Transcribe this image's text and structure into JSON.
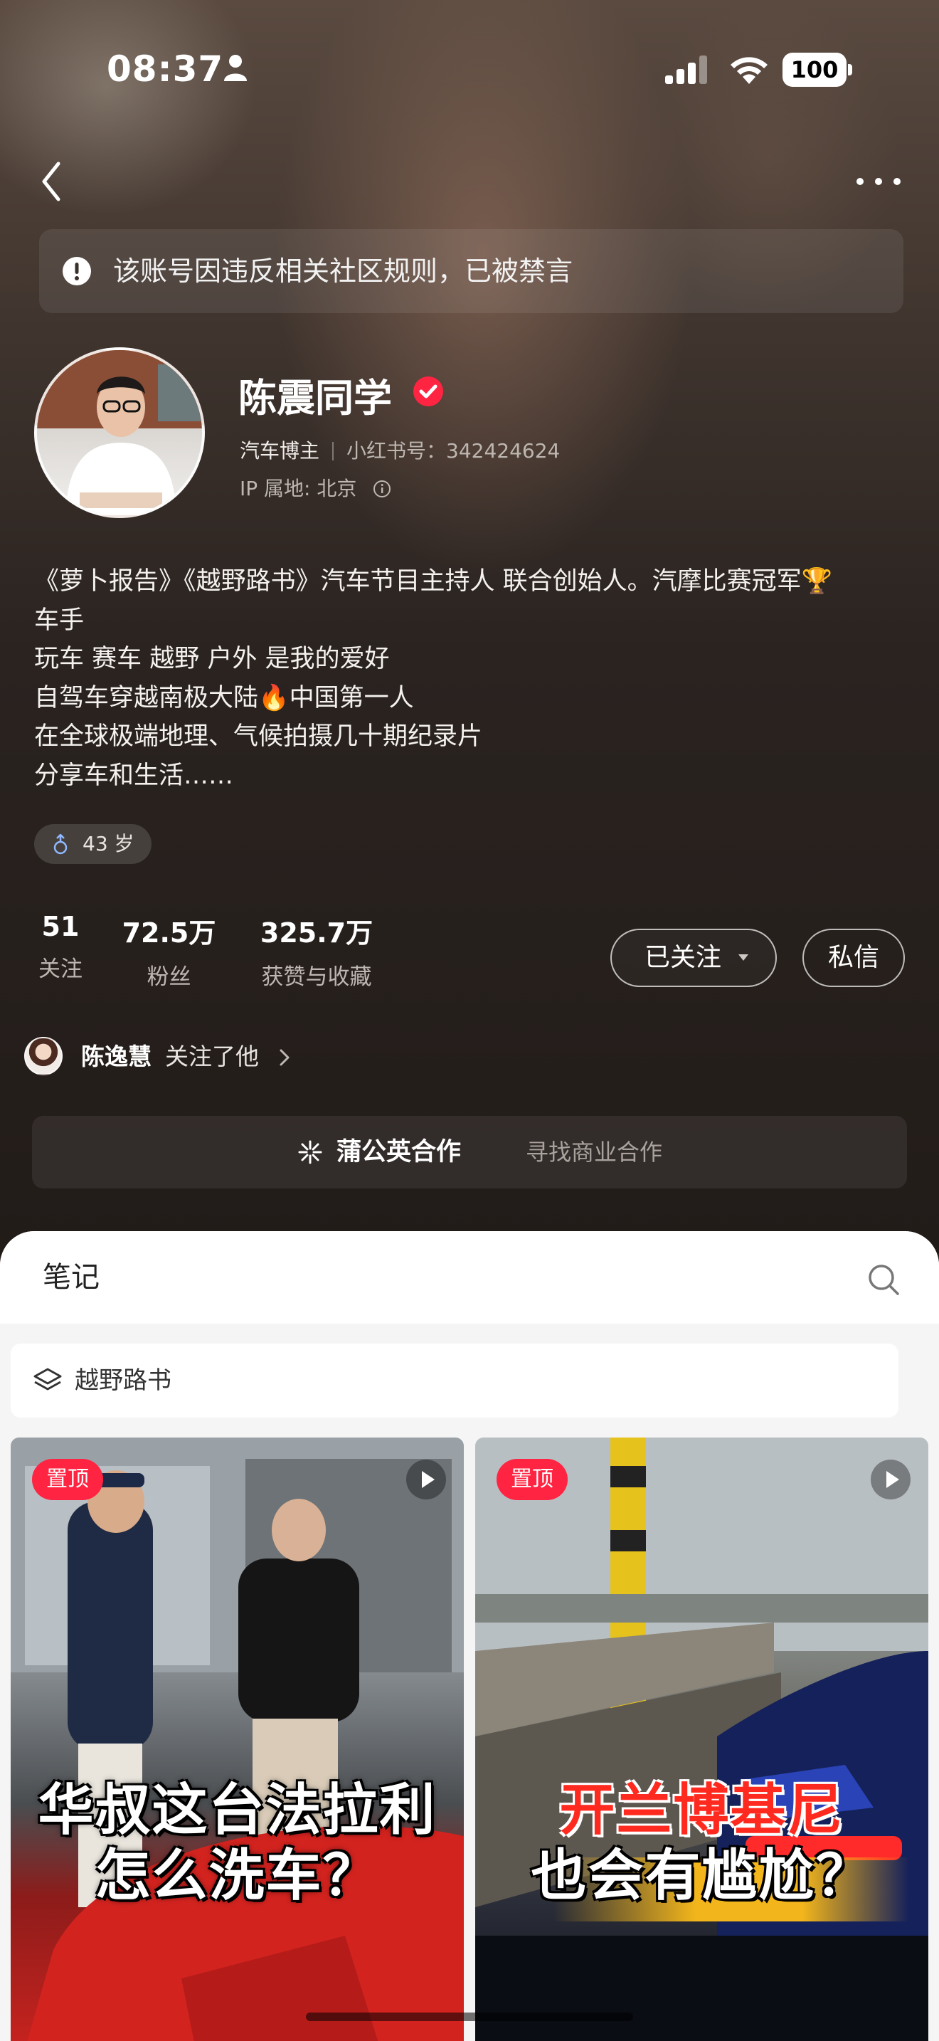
{
  "status_bar": {
    "time": "08:37",
    "battery": "100",
    "icons": [
      "person-icon",
      "signal-icon",
      "wifi-icon",
      "battery-icon"
    ]
  },
  "nav": {
    "back_icon": "chevron-left-icon",
    "more_icon": "more-icon"
  },
  "ban_notice": {
    "icon": "exclamation-circle-icon",
    "text": "该账号因违反相关社区规则，已被禁言"
  },
  "profile": {
    "name": "陈震同学",
    "verified": true,
    "role": "汽车博主",
    "id_label": "小红书号：",
    "id_value": "342424624",
    "ip": "IP 属地: 北京",
    "bio": [
      "《萝卜报告》《越野路书》汽车节目主持人 联合创始人。汽摩比赛冠军🏆",
      "车手",
      "玩车 赛车 越野 户外 是我的爱好",
      "自驾车穿越南极大陆🔥中国第一人",
      "在全球极端地理、气候拍摄几十期纪录片",
      "分享车和生活……"
    ],
    "age": "43 岁"
  },
  "stats": [
    {
      "value": "51",
      "label": "关注"
    },
    {
      "value": "72.5万",
      "label": "粉丝"
    },
    {
      "value": "325.7万",
      "label": "获赞与收藏"
    }
  ],
  "actions": {
    "following": "已关注",
    "message": "私信"
  },
  "mutual": {
    "name": "陈逸慧",
    "action": "关注了他"
  },
  "collab": {
    "title": "蒲公英合作",
    "subtitle": "寻找商业合作"
  },
  "content": {
    "tab": "笔记",
    "collection": "越野路书",
    "cards": [
      {
        "badge": "置顶",
        "caption": [
          "华叔这台法拉利",
          "怎么洗车？"
        ]
      },
      {
        "badge": "置顶",
        "caption": [
          "开兰博基尼",
          "也会有尴尬？"
        ]
      }
    ]
  },
  "colors": {
    "accent": "#ff2442",
    "sheet_bg": "#f5f5f5",
    "page_bg": "#221c19"
  }
}
